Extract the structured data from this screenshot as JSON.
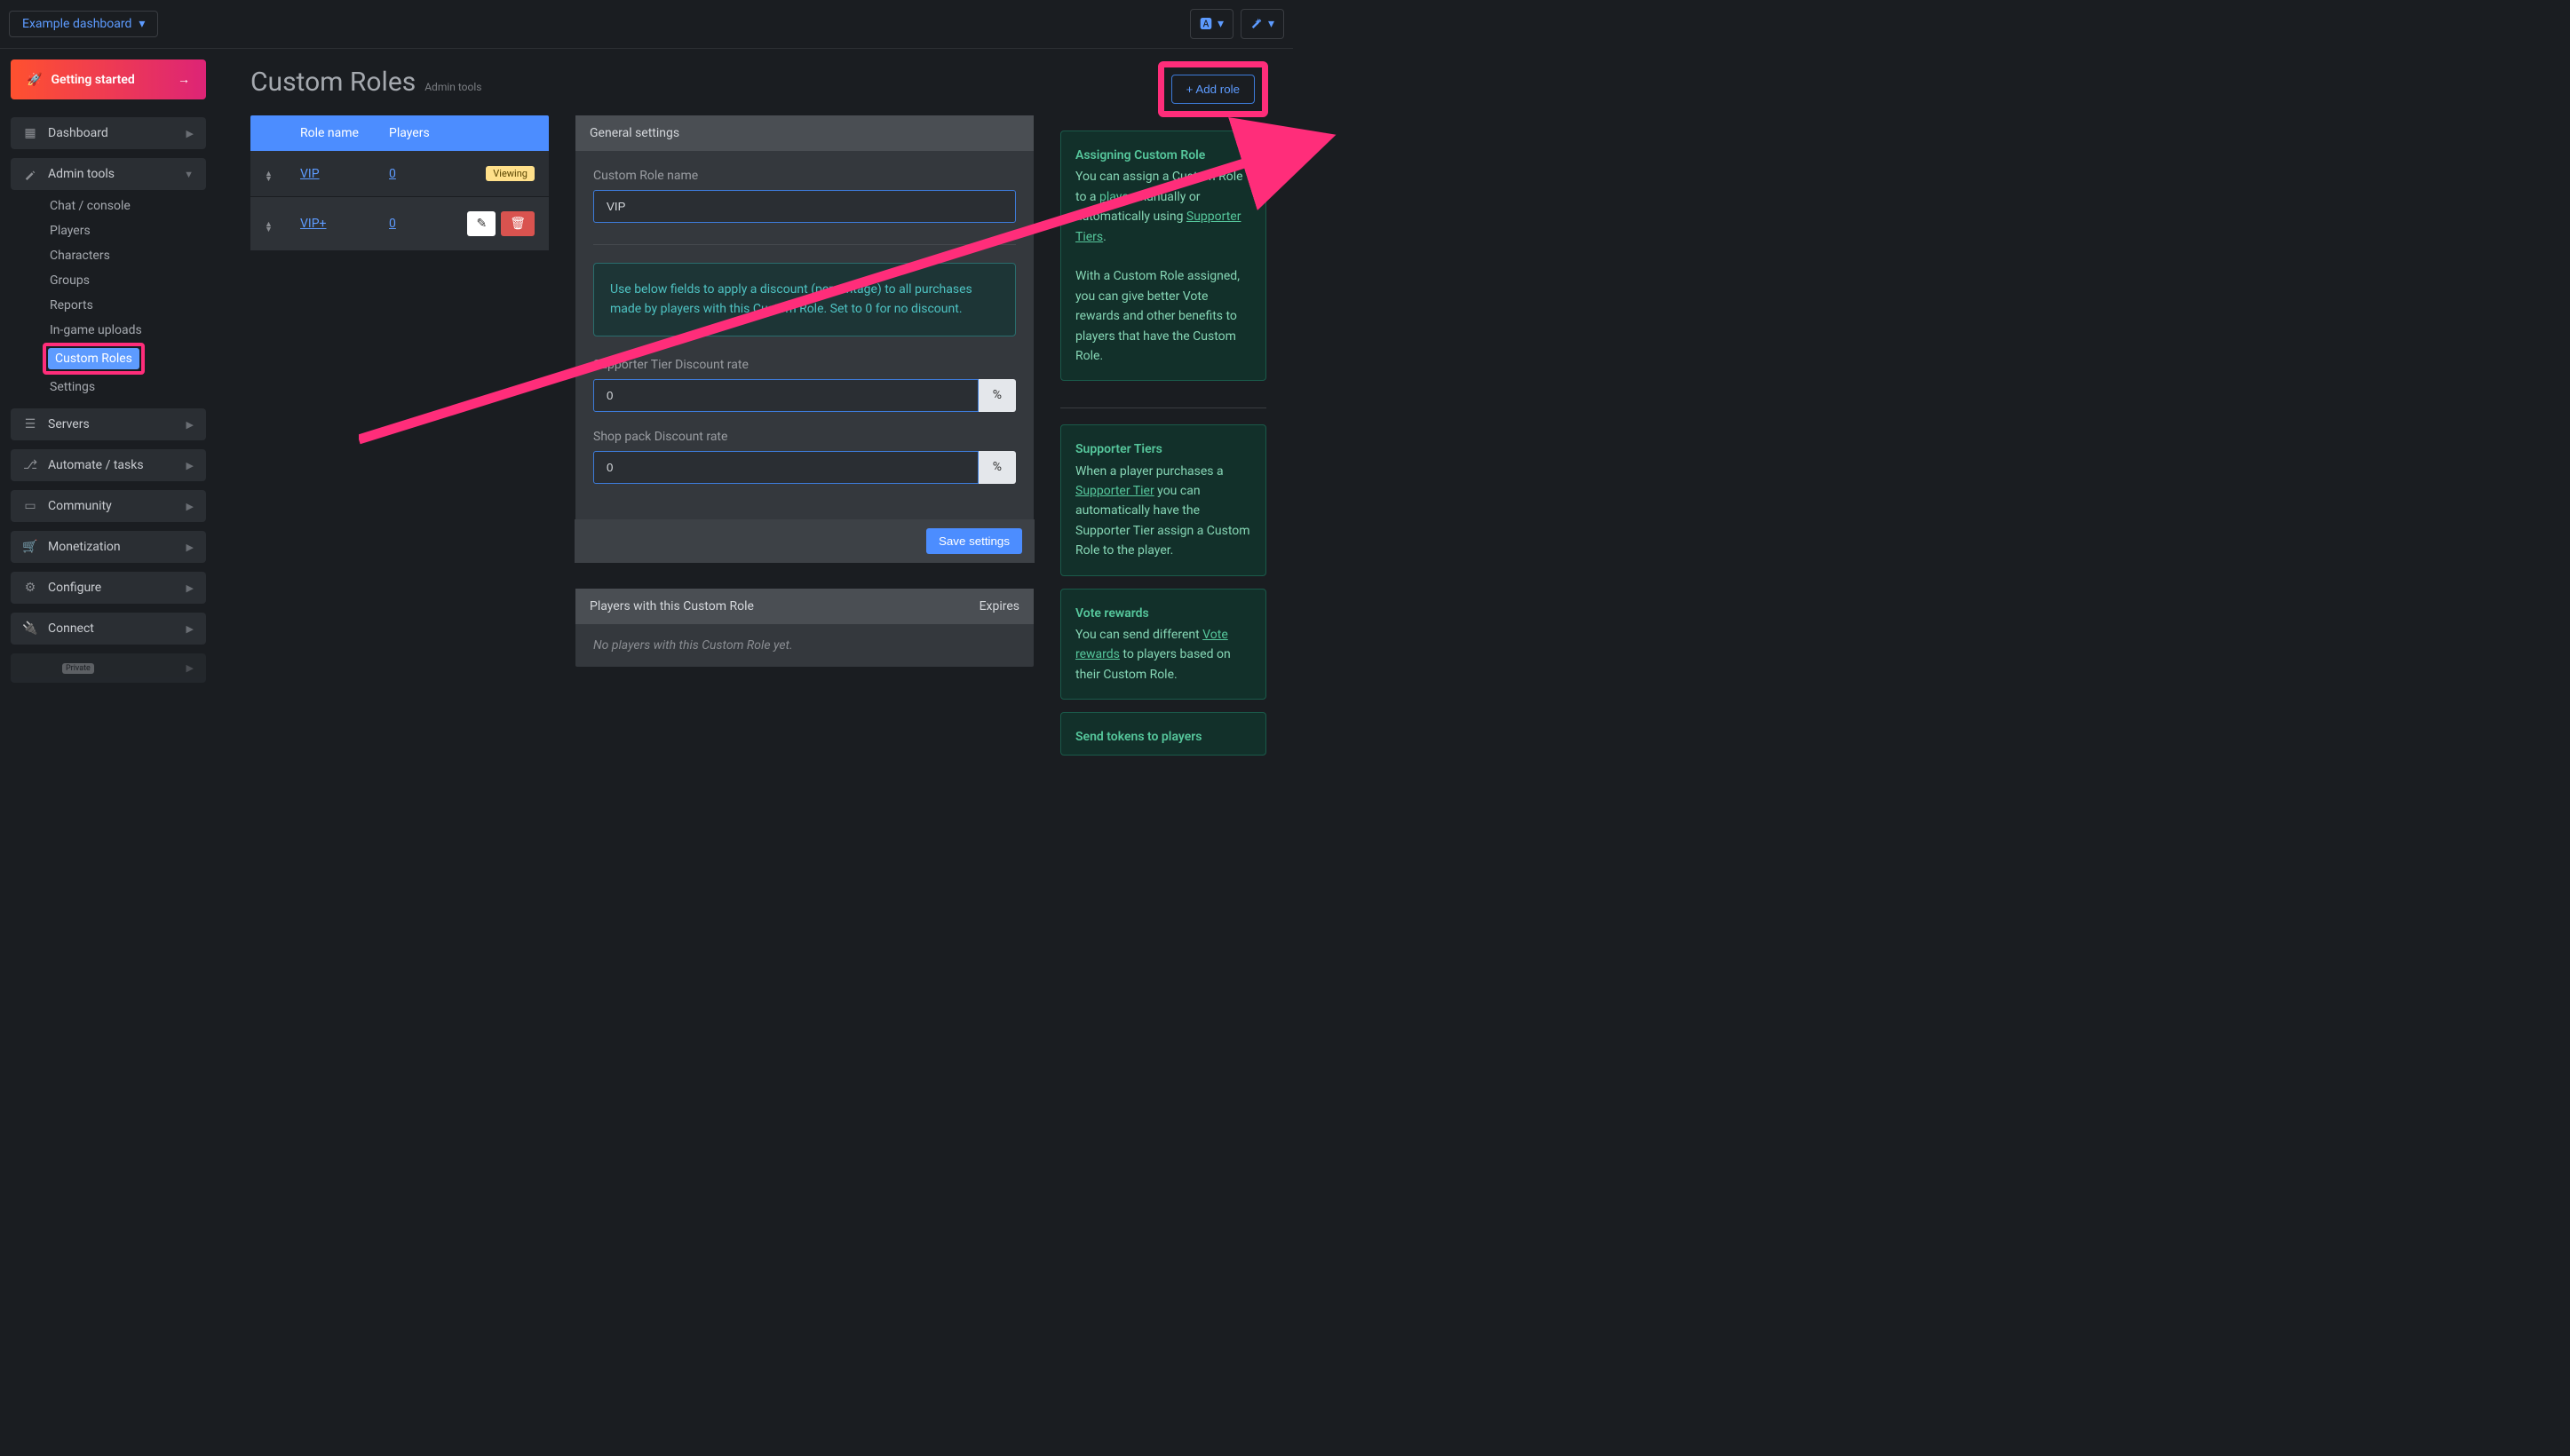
{
  "topbar": {
    "dashboard_select": "Example dashboard"
  },
  "sidebar": {
    "getting_started": "Getting started",
    "items": [
      {
        "label": "Dashboard",
        "icon": "grid"
      },
      {
        "label": "Admin tools",
        "icon": "wand",
        "expanded": true,
        "children": [
          "Chat / console",
          "Players",
          "Characters",
          "Groups",
          "Reports",
          "In-game uploads",
          "Custom Roles",
          "Settings"
        ],
        "active_child": "Custom Roles"
      },
      {
        "label": "Servers",
        "icon": "server"
      },
      {
        "label": "Automate / tasks",
        "icon": "branch"
      },
      {
        "label": "Community",
        "icon": "window"
      },
      {
        "label": "Monetization",
        "icon": "cart"
      },
      {
        "label": "Configure",
        "icon": "gear"
      },
      {
        "label": "Connect",
        "icon": "plug"
      }
    ],
    "private_badge": "Private"
  },
  "page": {
    "title": "Custom Roles",
    "subtitle": "Admin tools",
    "add_role_btn": "+ Add role"
  },
  "roles_table": {
    "headers": {
      "name": "Role name",
      "players": "Players"
    },
    "rows": [
      {
        "name": "VIP",
        "players": "0",
        "viewing": true
      },
      {
        "name": "VIP+",
        "players": "0",
        "viewing": false
      }
    ],
    "viewing_badge": "Viewing"
  },
  "general_settings": {
    "header": "General settings",
    "role_name_label": "Custom Role name",
    "role_name_value": "VIP",
    "info_text": "Use below fields to apply a discount (percentage) to all purchases made by players with this Custom Role. Set to 0 for no discount.",
    "tier_discount_label": "Supporter Tier Discount rate",
    "tier_discount_value": "0",
    "shop_discount_label": "Shop pack Discount rate",
    "shop_discount_value": "0",
    "percent": "%",
    "save_btn": "Save settings"
  },
  "players_panel": {
    "header": "Players with this Custom Role",
    "expires_header": "Expires",
    "empty": "No players with this Custom Role yet."
  },
  "help": {
    "card1": {
      "title": "Assigning Custom Role",
      "text1": "You can assign a Custom Role to a ",
      "link1": "player",
      "text2": " manually or automatically using ",
      "link2": "Supporter Tiers",
      "text3": ".",
      "text4": "With a Custom Role assigned, you can give better Vote rewards and other benefits to players that have the Custom Role."
    },
    "card2": {
      "title": "Supporter Tiers",
      "text1": "When a player purchases a ",
      "link1": "Supporter Tier",
      "text2": " you can automatically have the Supporter Tier assign a Custom Role to the player."
    },
    "card3": {
      "title": "Vote rewards",
      "text1": "You can send different ",
      "link1": "Vote rewards",
      "text2": " to players based on their Custom Role."
    },
    "card4": {
      "title": "Send tokens to players"
    }
  }
}
